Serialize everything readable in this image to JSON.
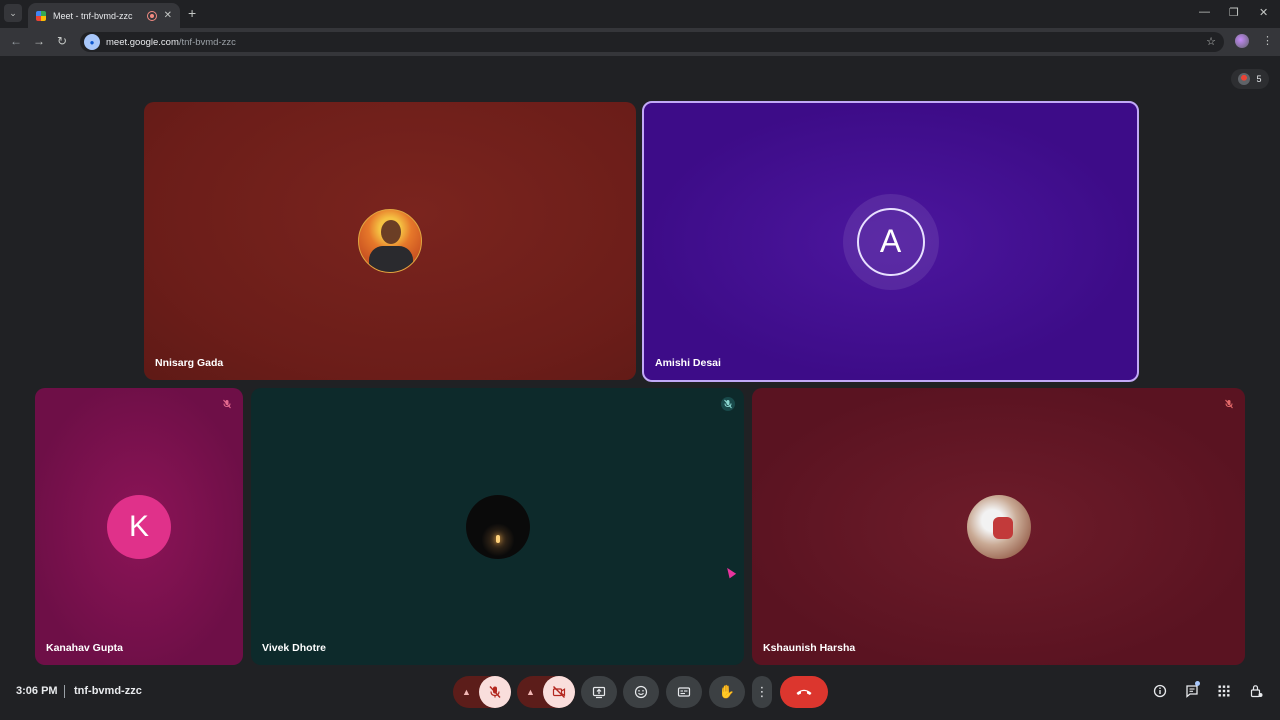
{
  "browser": {
    "tab_title": "Meet - tnf-bvmd-zzc",
    "new_tab_icon": "+",
    "url_main": "meet.google.com",
    "url_path": "/tnf-bvmd-zzc"
  },
  "meet": {
    "participant_count": "5",
    "tiles": [
      {
        "name": "Nnisarg Gada"
      },
      {
        "name": "Amishi Desai",
        "initial": "A"
      },
      {
        "name": "Kanahav Gupta",
        "initial": "K"
      },
      {
        "name": "Vivek Dhotre"
      },
      {
        "name": "Kshaunish Harsha"
      }
    ],
    "time": "3:06 PM",
    "meeting_code": "tnf-bvmd-zzc"
  },
  "colors": {
    "tile_nnisarg": "#6b1d19",
    "tile_amishi": "#3d0c88",
    "tile_kanahav": "#6e0f47",
    "tile_vivek": "#0d2a2b",
    "tile_kshaunish": "#5a1321",
    "end_call": "#dc362e"
  },
  "icons": {
    "mic_options": "chevron-up-icon",
    "mic": "mic-off-icon",
    "cam_options": "chevron-up-icon",
    "cam": "videocam-off-icon",
    "present": "present-screen-icon",
    "emoji": "emoji-icon",
    "captions": "captions-icon",
    "hand": "raise-hand-icon",
    "more": "more-options-icon",
    "end": "call-end-icon",
    "info": "info-icon",
    "chat": "chat-icon",
    "activities": "apps-grid-icon",
    "host": "host-controls-lock-icon"
  }
}
